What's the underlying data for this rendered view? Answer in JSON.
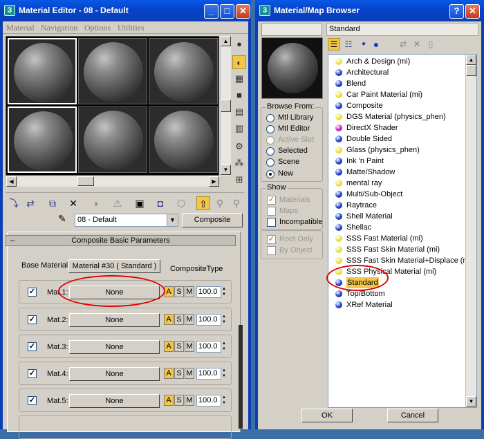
{
  "material_editor": {
    "title": "Material Editor - 08 - Default",
    "menu": [
      "Material",
      "Navigation",
      "Options",
      "Utilities"
    ],
    "material_name": "08 - Default",
    "type_button": "Composite",
    "rollout_title": "Composite Basic Parameters",
    "rollout_toggle": "–",
    "base_material_label": "Base Material:",
    "base_material_value": "Material #30  ( Standard )",
    "composite_type_label": "CompositeType",
    "mats": [
      {
        "label": "Mat.1:",
        "value": "None",
        "amount": "100.0"
      },
      {
        "label": "Mat.2:",
        "value": "None",
        "amount": "100.0"
      },
      {
        "label": "Mat.3:",
        "value": "None",
        "amount": "100.0"
      },
      {
        "label": "Mat.4:",
        "value": "None",
        "amount": "100.0"
      },
      {
        "label": "Mat.5:",
        "value": "None",
        "amount": "100.0"
      }
    ],
    "mode_buttons": [
      "A",
      "S",
      "M"
    ]
  },
  "browser": {
    "title": "Material/Map Browser",
    "name_field": "",
    "type_field": "Standard",
    "browse_from_label": "Browse From:",
    "browse_from": [
      {
        "label": "Mtl Library",
        "selected": false,
        "disabled": false
      },
      {
        "label": "Mtl Editor",
        "selected": false,
        "disabled": false
      },
      {
        "label": "Active Slot",
        "selected": false,
        "disabled": true
      },
      {
        "label": "Selected",
        "selected": false,
        "disabled": false
      },
      {
        "label": "Scene",
        "selected": false,
        "disabled": false
      },
      {
        "label": "New",
        "selected": true,
        "disabled": false
      }
    ],
    "show_label": "Show",
    "show": [
      {
        "label": "Materials",
        "checked": true,
        "disabled": true
      },
      {
        "label": "Maps",
        "checked": false,
        "disabled": true
      },
      {
        "label": "Incompatible",
        "checked": false,
        "disabled": false
      }
    ],
    "extra_options": [
      {
        "label": "Root Only",
        "checked": true,
        "disabled": true
      },
      {
        "label": "By Object",
        "checked": false,
        "disabled": true
      }
    ],
    "items": [
      {
        "label": "Arch & Design (mi)",
        "color": "#e8e03a"
      },
      {
        "label": "Architectural",
        "color": "#1c3bc8"
      },
      {
        "label": "Blend",
        "color": "#1c3bc8"
      },
      {
        "label": "Car Paint Material (mi)",
        "color": "#e8e03a"
      },
      {
        "label": "Composite",
        "color": "#1c3bc8"
      },
      {
        "label": "DGS Material (physics_phen)",
        "color": "#e8e03a"
      },
      {
        "label": "DirectX Shader",
        "color": "#c81cb4"
      },
      {
        "label": "Double Sided",
        "color": "#1c3bc8"
      },
      {
        "label": "Glass (physics_phen)",
        "color": "#e8e03a"
      },
      {
        "label": "Ink 'n Paint",
        "color": "#1c3bc8"
      },
      {
        "label": "Matte/Shadow",
        "color": "#1c3bc8"
      },
      {
        "label": "mental ray",
        "color": "#e8e03a"
      },
      {
        "label": "Multi/Sub-Object",
        "color": "#1c3bc8"
      },
      {
        "label": "Raytrace",
        "color": "#1c3bc8"
      },
      {
        "label": "Shell Material",
        "color": "#1c3bc8"
      },
      {
        "label": "Shellac",
        "color": "#1c3bc8"
      },
      {
        "label": "SSS Fast Material (mi)",
        "color": "#e8e03a"
      },
      {
        "label": "SSS Fast Skin Material (mi)",
        "color": "#e8e03a"
      },
      {
        "label": "SSS Fast Skin Material+Displace (mi)",
        "color": "#e8e03a"
      },
      {
        "label": "SSS Physical Material (mi)",
        "color": "#e8e03a"
      },
      {
        "label": "Standard",
        "color": "#1c3bc8"
      },
      {
        "label": "Top/Bottom",
        "color": "#1c3bc8"
      },
      {
        "label": "XRef Material",
        "color": "#1c3bc8"
      }
    ],
    "selected_item": "Standard",
    "ok": "OK",
    "cancel": "Cancel"
  },
  "colors": {
    "accent": "#f3c64a",
    "titlebar": "#0a58e6",
    "annotation": "#e00000"
  }
}
